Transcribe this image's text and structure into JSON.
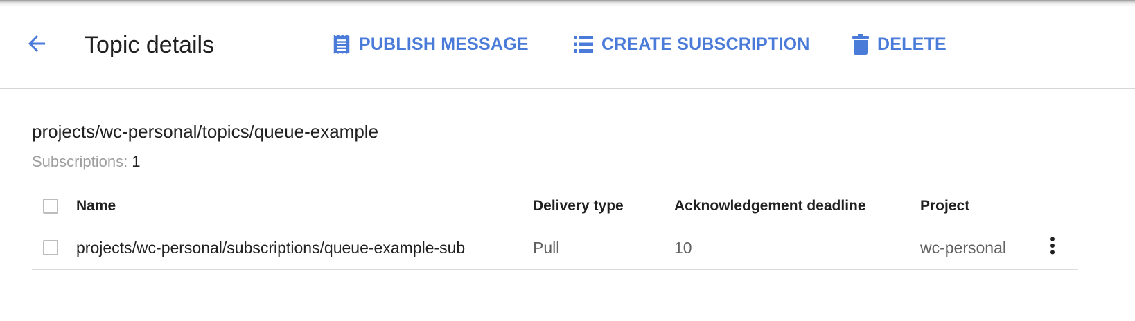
{
  "header": {
    "title": "Topic details",
    "actions": {
      "publish": "PUBLISH MESSAGE",
      "create_subscription": "CREATE SUBSCRIPTION",
      "delete": "DELETE"
    }
  },
  "topic": {
    "name": "projects/wc-personal/topics/queue-example",
    "subscriptions_label": "Subscriptions:",
    "subscriptions_count": "1"
  },
  "table": {
    "columns": {
      "name": "Name",
      "delivery_type": "Delivery type",
      "ack_deadline": "Acknowledgement deadline",
      "project": "Project"
    },
    "rows": [
      {
        "name": "projects/wc-personal/subscriptions/queue-example-sub",
        "delivery_type": "Pull",
        "ack_deadline": "10",
        "project": "wc-personal"
      }
    ]
  },
  "colors": {
    "accent": "#4a7bd9",
    "text_primary": "#212121",
    "text_secondary": "#616161",
    "text_muted": "#9e9e9e",
    "divider": "#dcdcdc"
  },
  "icons": {
    "back": "arrow-back-icon",
    "publish": "receipt-icon",
    "create_subscription": "list-icon",
    "delete": "trash-icon",
    "row_menu": "more-vert-icon"
  }
}
